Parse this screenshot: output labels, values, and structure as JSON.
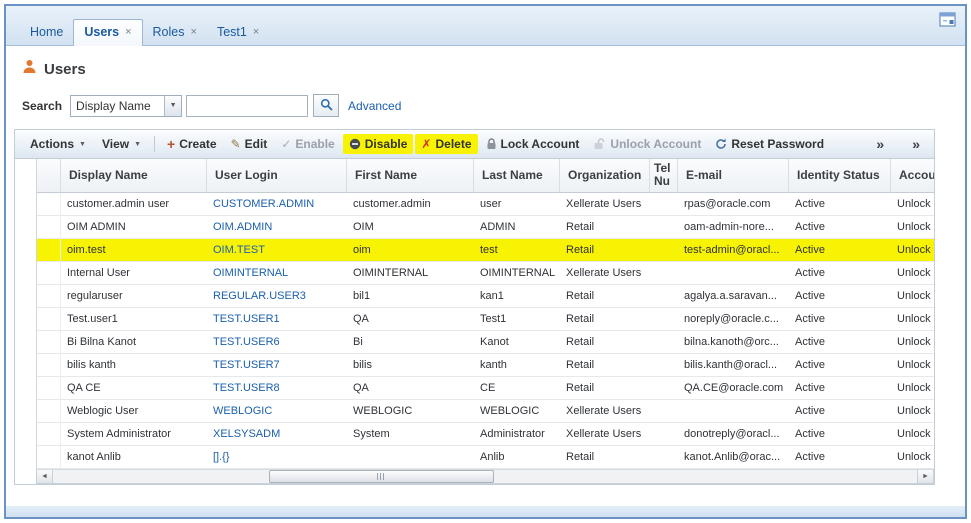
{
  "colors": {
    "marker_yellow": "#f8f303",
    "link_blue": "#1a5fad",
    "tab_blue": "#1a5a9e",
    "title_icon_orange": "#e2772e"
  },
  "glyphs": {
    "dropdown": "▼",
    "close": "×"
  },
  "tabs": {
    "items": [
      {
        "label": "Home",
        "closable": false,
        "active": false
      },
      {
        "label": "Users",
        "closable": true,
        "active": true
      },
      {
        "label": "Roles",
        "closable": true,
        "active": false
      },
      {
        "label": "Test1",
        "closable": true,
        "active": false
      }
    ]
  },
  "page": {
    "title": "Users"
  },
  "search": {
    "label": "Search",
    "selected_field": "Display Name",
    "input_value": "",
    "advanced_label": "Advanced"
  },
  "toolbar": {
    "actions": "Actions",
    "view": "View",
    "overflow_glyph": "»",
    "buttons": [
      {
        "label": "Create",
        "icon": "plus-icon",
        "glyph": "+"
      },
      {
        "label": "Edit",
        "icon": "pencil-icon",
        "glyph": "✎"
      },
      {
        "label": "Enable",
        "icon": "check-icon",
        "glyph": "✓",
        "disabled": true
      },
      {
        "label": "Disable",
        "icon": "minus-circle-icon",
        "highlighted": true
      },
      {
        "label": "Delete",
        "icon": "x-icon",
        "glyph": "✗",
        "highlighted": true
      },
      {
        "label": "Lock Account",
        "icon": "lock-icon"
      },
      {
        "label": "Unlock Account",
        "icon": "unlock-icon",
        "disabled": true
      },
      {
        "label": "Reset Password",
        "icon": "reset-icon"
      }
    ]
  },
  "table": {
    "columns": [
      "Display Name",
      "User Login",
      "First Name",
      "Last Name",
      "Organization",
      "Tel Nu",
      "E-mail",
      "Identity Status",
      "Accou"
    ],
    "rows": [
      {
        "display_name": "customer.admin user",
        "user_login": "CUSTOMER.ADMIN",
        "first_name": "customer.admin",
        "last_name": "user",
        "organization": "Xellerate Users",
        "telephone": "",
        "email": "rpas@oracle.com",
        "identity_status": "Active",
        "account_status": "Unlock",
        "highlighted": false
      },
      {
        "display_name": "OIM ADMIN",
        "user_login": "OIM.ADMIN",
        "first_name": "OIM",
        "last_name": "ADMIN",
        "organization": "Retail",
        "telephone": "",
        "email": "oam-admin-nore...",
        "identity_status": "Active",
        "account_status": "Unlock",
        "highlighted": false
      },
      {
        "display_name": "oim.test",
        "user_login": "OIM.TEST",
        "first_name": "oim",
        "last_name": "test",
        "organization": "Retail",
        "telephone": "",
        "email": "test-admin@oracl...",
        "identity_status": "Active",
        "account_status": "Unlock",
        "highlighted": true
      },
      {
        "display_name": "Internal User",
        "user_login": "OIMINTERNAL",
        "first_name": "OIMINTERNAL",
        "last_name": "OIMINTERNAL",
        "organization": "Xellerate Users",
        "telephone": "",
        "email": "",
        "identity_status": "Active",
        "account_status": "Unlock",
        "highlighted": false
      },
      {
        "display_name": "regularuser",
        "user_login": "REGULAR.USER3",
        "first_name": "bil1",
        "last_name": "kan1",
        "organization": "Retail",
        "telephone": "",
        "email": "agalya.a.saravan...",
        "identity_status": "Active",
        "account_status": "Unlock",
        "highlighted": false
      },
      {
        "display_name": "Test.user1",
        "user_login": "TEST.USER1",
        "first_name": "QA",
        "last_name": "Test1",
        "organization": "Retail",
        "telephone": "",
        "email": "noreply@oracle.c...",
        "identity_status": "Active",
        "account_status": "Unlock",
        "highlighted": false
      },
      {
        "display_name": "Bi Bilna Kanot",
        "user_login": "TEST.USER6",
        "first_name": "Bi",
        "last_name": "Kanot",
        "organization": "Retail",
        "telephone": "",
        "email": "bilna.kanoth@orc...",
        "identity_status": "Active",
        "account_status": "Unlock",
        "highlighted": false
      },
      {
        "display_name": "bilis kanth",
        "user_login": "TEST.USER7",
        "first_name": "bilis",
        "last_name": "kanth",
        "organization": "Retail",
        "telephone": "",
        "email": "bilis.kanth@oracl...",
        "identity_status": "Active",
        "account_status": "Unlock",
        "highlighted": false
      },
      {
        "display_name": "QA CE",
        "user_login": "TEST.USER8",
        "first_name": "QA",
        "last_name": "CE",
        "organization": "Retail",
        "telephone": "",
        "email": "QA.CE@oracle.com",
        "identity_status": "Active",
        "account_status": "Unlock",
        "highlighted": false
      },
      {
        "display_name": "Weblogic User",
        "user_login": "WEBLOGIC",
        "first_name": "WEBLOGIC",
        "last_name": "WEBLOGIC",
        "organization": "Xellerate Users",
        "telephone": "",
        "email": "",
        "identity_status": "Active",
        "account_status": "Unlock",
        "highlighted": false
      },
      {
        "display_name": "System Administrator",
        "user_login": "XELSYSADM",
        "first_name": "System",
        "last_name": "Administrator",
        "organization": "Xellerate Users",
        "telephone": "",
        "email": "donotreply@oracl...",
        "identity_status": "Active",
        "account_status": "Unlock",
        "highlighted": false
      },
      {
        "display_name": "kanot Anlib",
        "user_login": "[].{}",
        "first_name": "",
        "last_name": "Anlib",
        "organization": "Retail",
        "telephone": "",
        "email": "kanot.Anlib@orac...",
        "identity_status": "Active",
        "account_status": "Unlock",
        "highlighted": false
      }
    ]
  },
  "scrollbar": {
    "left_glyph": "◄",
    "right_glyph": "►"
  }
}
